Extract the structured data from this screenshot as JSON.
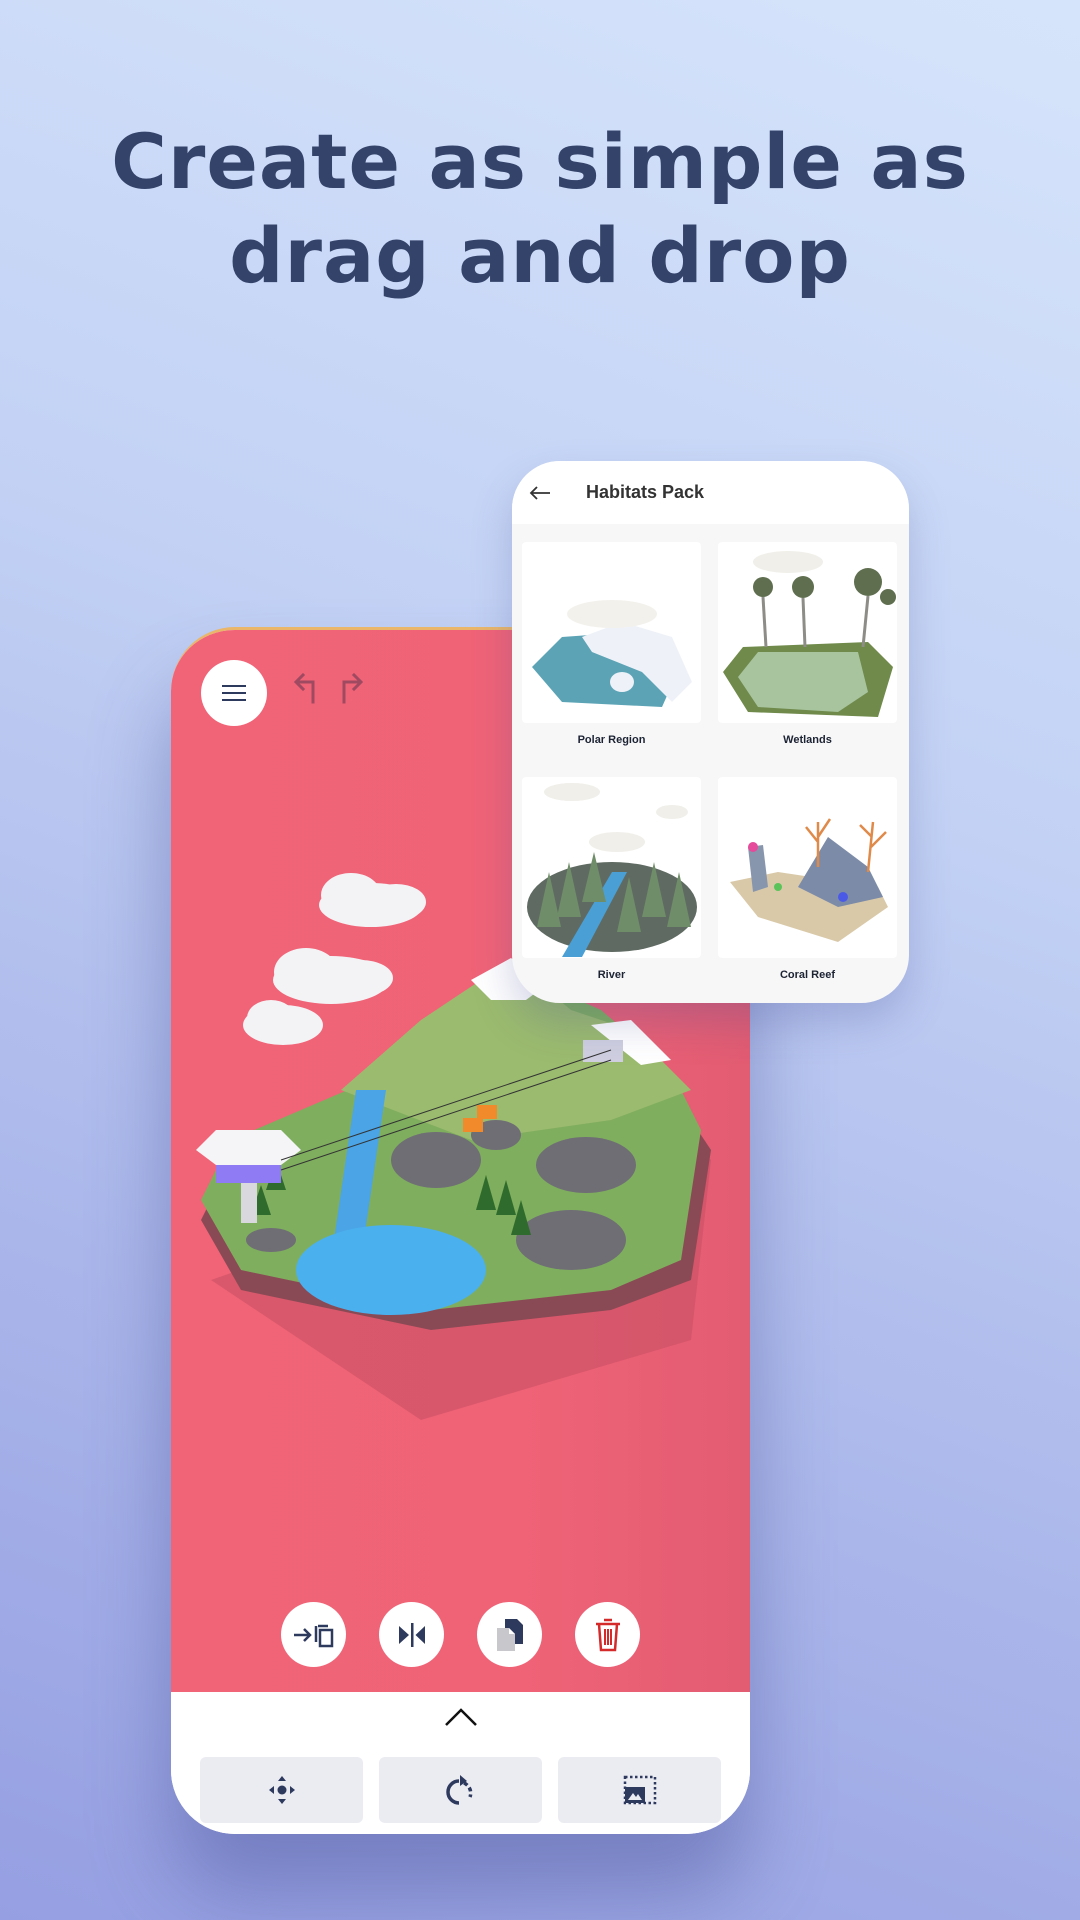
{
  "headline": {
    "line1": "Create as simple as",
    "line2": "drag and drop"
  },
  "colors": {
    "headline": "#34436a",
    "canvas": "#f16477",
    "icon_dark": "#2d3a5e",
    "delete_red": "#d42a2a",
    "tool_bg": "#ebebf2"
  },
  "editor": {
    "top_bar": {
      "menu_icon": "hamburger-icon",
      "undo_icon": "undo-arrow-icon",
      "redo_icon": "redo-arrow-icon"
    },
    "scene": "Mountain island with waterfall, lake, cable car and clouds",
    "actions": [
      {
        "name": "move-to-copy",
        "icon": "arrow-into-copy-icon"
      },
      {
        "name": "mirror",
        "icon": "flip-horizontal-icon"
      },
      {
        "name": "duplicate",
        "icon": "duplicate-files-icon"
      },
      {
        "name": "delete",
        "icon": "trash-icon"
      }
    ],
    "panel": {
      "expand_icon": "chevron-up-icon",
      "tools": [
        {
          "name": "move",
          "icon": "move-arrows-icon"
        },
        {
          "name": "rotate",
          "icon": "rotate-icon"
        },
        {
          "name": "resize",
          "icon": "resize-image-icon"
        }
      ]
    }
  },
  "pack": {
    "back_icon": "back-arrow-icon",
    "title": "Habitats Pack",
    "items": [
      {
        "label": "Polar Region"
      },
      {
        "label": "Wetlands"
      },
      {
        "label": "River"
      },
      {
        "label": "Coral Reef"
      }
    ]
  }
}
